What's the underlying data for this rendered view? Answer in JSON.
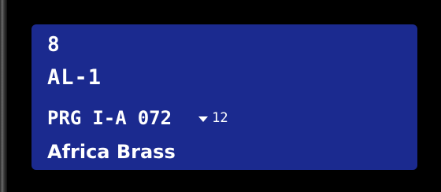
{
  "display": {
    "part_number": "8",
    "patch_id": "AL-1",
    "program": {
      "label": "PRG",
      "bank": "I-A",
      "number": "072",
      "count": "12"
    },
    "patch_name": "Africa Brass"
  },
  "colors": {
    "panel_background": "#1b2a8f",
    "text": "#ffffff",
    "screen_background": "#000000"
  },
  "icons": {
    "dropdown": "down-triangle-icon"
  }
}
